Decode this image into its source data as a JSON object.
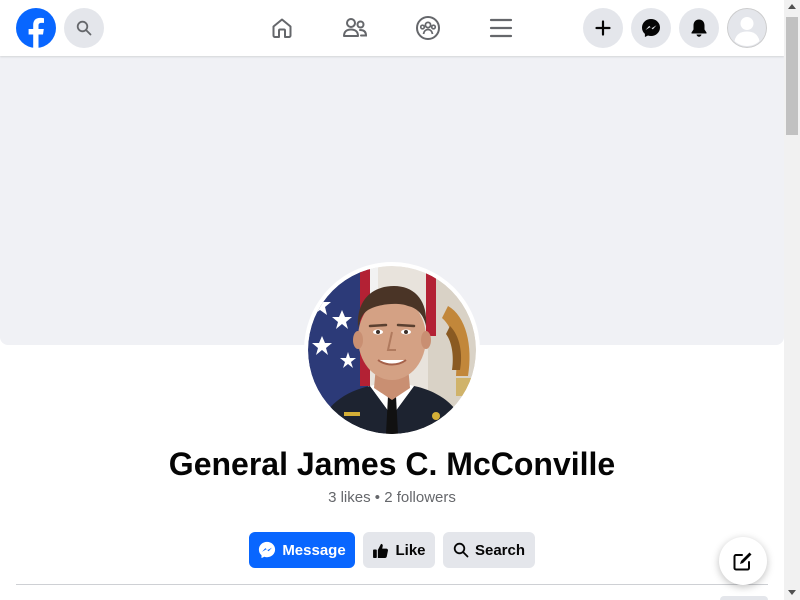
{
  "topbar": {
    "logo": "facebook-logo-icon",
    "search_icon": "search-icon",
    "nav": [
      "home-icon",
      "friends-icon",
      "groups-icon",
      "menu-icon"
    ],
    "actions": [
      "plus-icon",
      "messenger-icon",
      "bell-icon",
      "avatar"
    ]
  },
  "profile": {
    "name": "General James C. McConville",
    "stats": "3 likes • 2 followers"
  },
  "buttons": {
    "message": "Message",
    "like": "Like",
    "search": "Search"
  },
  "colors": {
    "brand": "#0866ff",
    "button_gray": "#e4e6eb",
    "cover": "#f0f1f5",
    "secondary_text": "#65676b"
  }
}
